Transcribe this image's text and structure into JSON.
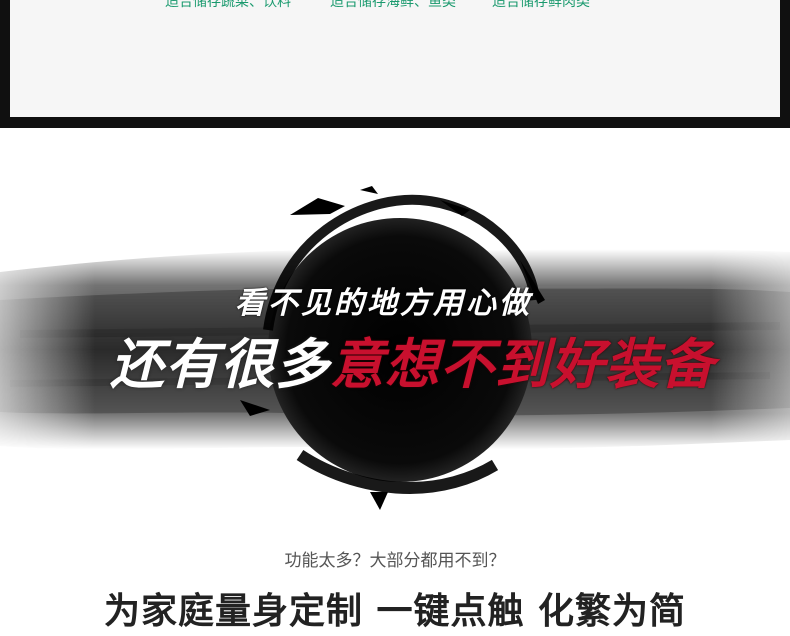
{
  "storage_labels": [
    "适合储存蔬菜、饮料",
    "适合储存海鲜、鱼类",
    "适合储存鲜肉类"
  ],
  "banner": {
    "line1": "看不见的地方用心做",
    "line2_plain": "还有很多",
    "line2_highlight": "意想不到好装备"
  },
  "sub_question": "功能太多？大部分都用不到？",
  "main_slogan": "为家庭量身定制 一键点触 化繁为简",
  "colors": {
    "frame": "#101010",
    "storage_label": "#1a9a6e",
    "highlight_red": "#c8102e",
    "ink": "#111111"
  }
}
